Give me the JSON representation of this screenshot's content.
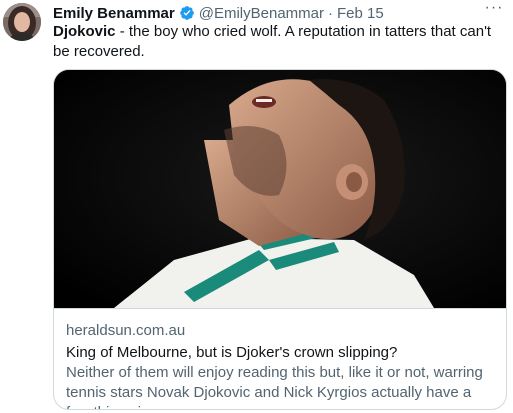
{
  "tweet": {
    "author_name": "Emily Benammar",
    "handle": "@EmilyBenammar",
    "separator": "·",
    "date": "Feb 15",
    "more_label": "···",
    "text_bold": "Djokovic",
    "text_rest": " - the boy who cried wolf. A reputation in tatters that can't be recovered."
  },
  "card": {
    "domain": "heraldsun.com.au",
    "title": "King of Melbourne, but is Djoker's crown slipping?",
    "description": "Neither of them will enjoy reading this but, like it or not, warring tennis stars Novak Djokovic and Nick Kyrgios actually have a few things in ..."
  },
  "icons": {
    "verified": "verified-badge-icon",
    "more": "more-options-icon"
  },
  "colors": {
    "verified_blue": "#1d9bf0",
    "secondary_text": "#536471",
    "border": "#cfd9de",
    "shirt_green": "#1a8a7a"
  }
}
